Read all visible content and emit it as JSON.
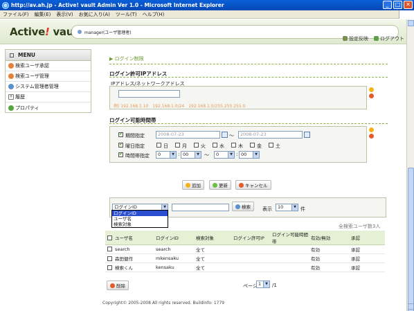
{
  "window": {
    "title": "http://av.ah.jp - Active! vault Admin Ver 1.0 - Microsoft Internet Explorer"
  },
  "menubar": {
    "items": [
      "ファイル(F)",
      "編集(E)",
      "表示(V)",
      "お気に入り(A)",
      "ツール(T)",
      "ヘルプ(H)"
    ]
  },
  "header": {
    "logo_left": "Active",
    "logo_bang": "!",
    "logo_right": " vault",
    "user_label": "manager(ユーザ管理者)",
    "links": [
      "設定反映",
      "ログアウト"
    ]
  },
  "sidebar": {
    "title": "MENU",
    "items": [
      {
        "label": "検索ユーザ承認",
        "color": "#e8803a"
      },
      {
        "label": "検索ユーザ管理",
        "color": "#e8803a"
      },
      {
        "label": "システム管理者管理",
        "color": "#5a8fd0"
      },
      {
        "label": "履歴",
        "color": "#8a8a8a"
      },
      {
        "label": "プロパティ",
        "color": "#5aa343"
      }
    ]
  },
  "main": {
    "breadcrumb": "▶ ログイン制限",
    "ip_section": {
      "title": "ログイン許可IPアドレス",
      "label": "IPアドレス/ネットワークアドレス",
      "value": "",
      "hint": "例) 192.168.1.10　192.168.1.0/24　192.168.1.0/255.255.255.0"
    },
    "time_section": {
      "title": "ログイン可能時間帯",
      "period_label": "期間指定",
      "date_from": "2008-07-23",
      "tilde": "〜",
      "date_to": "2008-07-23",
      "weekday_label": "曜日指定",
      "weekdays": [
        "日",
        "月",
        "火",
        "水",
        "木",
        "金",
        "土"
      ],
      "timespan_label": "時間帯指定",
      "time_from_h": "0",
      "time_from_m": "00",
      "time_to_h": "0",
      "time_to_m": "00"
    },
    "buttons": {
      "add": "追加",
      "update": "更新",
      "cancel": "キャンセル"
    },
    "search": {
      "field_select": "ログインID",
      "options": [
        "ログインID",
        "ユーザ名",
        "検索対象"
      ],
      "query": "",
      "search_button": "検索",
      "display_label": "表示",
      "page_size": "10",
      "page_size_unit": "件",
      "total": "全検索ユーザ数3人"
    },
    "table": {
      "headers": [
        "ユーザ名",
        "ログインID",
        "検索対象",
        "ログイン許可IP",
        "ログイン可能時間帯",
        "有効/無効",
        "承認"
      ],
      "rows": [
        [
          "search",
          "search",
          "全て",
          "",
          "",
          "有効",
          "承認"
        ],
        [
          "森田健作",
          "mkensaku",
          "全て",
          "",
          "",
          "有効",
          "承認"
        ],
        [
          "検索くん",
          "kensaku",
          "全て",
          "",
          "",
          "有効",
          "承認"
        ]
      ]
    },
    "delete_button": "削除",
    "pager": {
      "label": "ページ",
      "value": "1",
      "total": "/1"
    }
  },
  "footer": "Copyright© 2005-2008 All rights reserved. BuildInfo: 1779"
}
